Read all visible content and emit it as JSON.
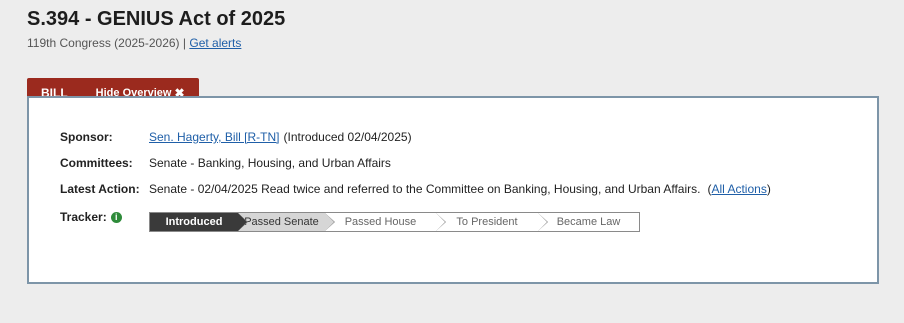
{
  "header": {
    "title": "S.394 - GENIUS Act of 2025",
    "congress": "119th Congress (2025-2026)",
    "separator": "|",
    "alerts_link": "Get alerts"
  },
  "tabs": {
    "bill": "BILL",
    "hide_overview": "Hide Overview",
    "hide_icon": "✖"
  },
  "overview": {
    "sponsor_label": "Sponsor:",
    "sponsor_name": "Sen. Hagerty, Bill [R-TN]",
    "sponsor_intro": "(Introduced 02/04/2025)",
    "committees_label": "Committees:",
    "committees_value": "Senate - Banking, Housing, and Urban Affairs",
    "latest_action_label": "Latest Action:",
    "latest_action_value": "Senate - 02/04/2025 Read twice and referred to the Committee on Banking, Housing, and Urban Affairs.",
    "all_actions_open": "(",
    "all_actions_link": "All Actions",
    "all_actions_close": ")",
    "tracker_label": "Tracker:",
    "tracker_icon": "info-icon"
  },
  "tracker": {
    "steps": [
      {
        "label": "Introduced",
        "state": "done"
      },
      {
        "label": "Passed Senate",
        "state": "current"
      },
      {
        "label": "Passed House",
        "state": "pending"
      },
      {
        "label": "To President",
        "state": "pending"
      },
      {
        "label": "Became Law",
        "state": "pending"
      }
    ]
  }
}
